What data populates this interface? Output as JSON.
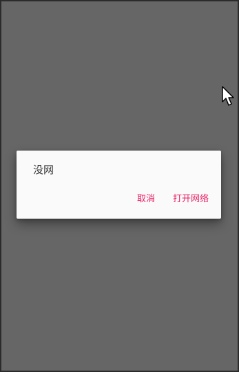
{
  "colors": {
    "overlay": "#666666",
    "dialog_background": "#fafafa",
    "message_text": "#333333",
    "accent": "#e91e63"
  },
  "cursor": {
    "icon": "mouse-pointer-icon"
  },
  "dialog": {
    "message": "没网",
    "buttons": {
      "cancel_label": "取消",
      "open_network_label": "打开网络"
    }
  }
}
